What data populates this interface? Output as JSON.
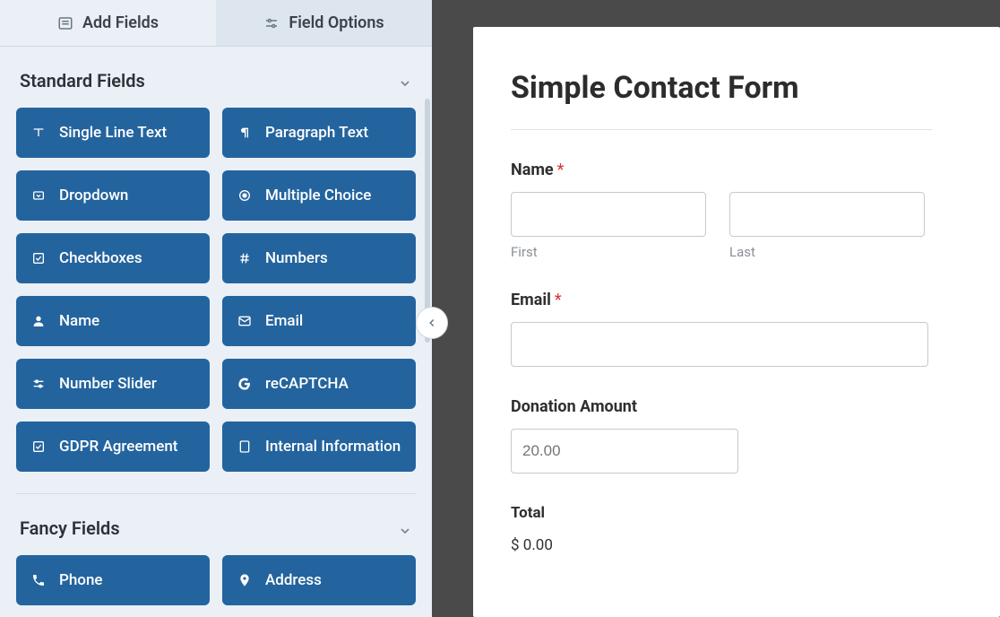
{
  "tabs": {
    "add_fields": "Add Fields",
    "field_options": "Field Options"
  },
  "sections": {
    "standard": {
      "title": "Standard Fields",
      "fields": [
        {
          "label": "Single Line Text"
        },
        {
          "label": "Paragraph Text"
        },
        {
          "label": "Dropdown"
        },
        {
          "label": "Multiple Choice"
        },
        {
          "label": "Checkboxes"
        },
        {
          "label": "Numbers"
        },
        {
          "label": "Name"
        },
        {
          "label": "Email"
        },
        {
          "label": "Number Slider"
        },
        {
          "label": "reCAPTCHA"
        },
        {
          "label": "GDPR Agreement"
        },
        {
          "label": "Internal Information"
        }
      ]
    },
    "fancy": {
      "title": "Fancy Fields",
      "fields": [
        {
          "label": "Phone"
        },
        {
          "label": "Address"
        }
      ]
    }
  },
  "preview": {
    "title": "Simple Contact Form",
    "name": {
      "label": "Name",
      "first": "First",
      "last": "Last"
    },
    "email": {
      "label": "Email"
    },
    "donation": {
      "label": "Donation Amount",
      "placeholder": "20.00"
    },
    "total": {
      "label": "Total",
      "value": "$ 0.00"
    }
  }
}
